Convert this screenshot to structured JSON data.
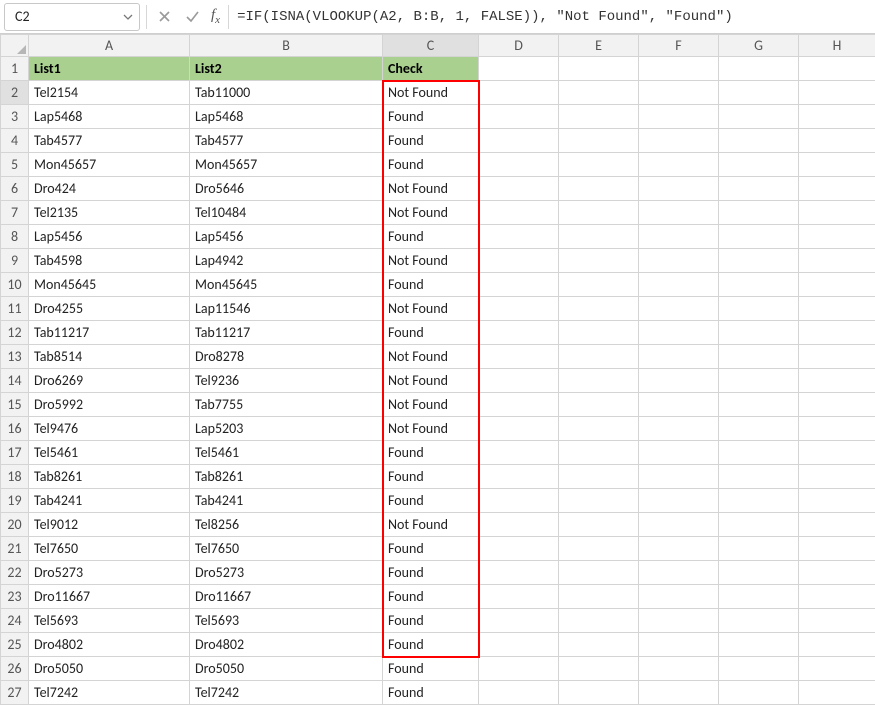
{
  "nameBox": {
    "value": "C2"
  },
  "formulaBar": {
    "formula": "=IF(ISNA(VLOOKUP(A2, B:B, 1, FALSE)), \"Not Found\", \"Found\")"
  },
  "columns": [
    "A",
    "B",
    "C",
    "D",
    "E",
    "F",
    "G",
    "H"
  ],
  "headers": {
    "A": "List1",
    "B": "List2",
    "C": "Check"
  },
  "selectedCell": "C2",
  "highlight": {
    "range": "C2:C25"
  },
  "rows": [
    {
      "n": 2,
      "A": "Tel2154",
      "B": "Tab11000",
      "C": "Not Found"
    },
    {
      "n": 3,
      "A": "Lap5468",
      "B": "Lap5468",
      "C": "Found"
    },
    {
      "n": 4,
      "A": "Tab4577",
      "B": "Tab4577",
      "C": "Found"
    },
    {
      "n": 5,
      "A": "Mon45657",
      "B": "Mon45657",
      "C": "Found"
    },
    {
      "n": 6,
      "A": "Dro424",
      "B": "Dro5646",
      "C": "Not Found"
    },
    {
      "n": 7,
      "A": "Tel2135",
      "B": "Tel10484",
      "C": "Not Found"
    },
    {
      "n": 8,
      "A": "Lap5456",
      "B": "Lap5456",
      "C": "Found"
    },
    {
      "n": 9,
      "A": "Tab4598",
      "B": "Lap4942",
      "C": "Not Found"
    },
    {
      "n": 10,
      "A": "Mon45645",
      "B": "Mon45645",
      "C": "Found"
    },
    {
      "n": 11,
      "A": "Dro4255",
      "B": "Lap11546",
      "C": "Not Found"
    },
    {
      "n": 12,
      "A": "Tab11217",
      "B": "Tab11217",
      "C": "Found"
    },
    {
      "n": 13,
      "A": "Tab8514",
      "B": "Dro8278",
      "C": "Not Found"
    },
    {
      "n": 14,
      "A": "Dro6269",
      "B": "Tel9236",
      "C": "Not Found"
    },
    {
      "n": 15,
      "A": "Dro5992",
      "B": "Tab7755",
      "C": "Not Found"
    },
    {
      "n": 16,
      "A": "Tel9476",
      "B": "Lap5203",
      "C": "Not Found"
    },
    {
      "n": 17,
      "A": "Tel5461",
      "B": "Tel5461",
      "C": "Found"
    },
    {
      "n": 18,
      "A": "Tab8261",
      "B": "Tab8261",
      "C": "Found"
    },
    {
      "n": 19,
      "A": "Tab4241",
      "B": "Tab4241",
      "C": "Found"
    },
    {
      "n": 20,
      "A": "Tel9012",
      "B": "Tel8256",
      "C": "Not Found"
    },
    {
      "n": 21,
      "A": "Tel7650",
      "B": "Tel7650",
      "C": "Found"
    },
    {
      "n": 22,
      "A": "Dro5273",
      "B": "Dro5273",
      "C": "Found"
    },
    {
      "n": 23,
      "A": "Dro11667",
      "B": "Dro11667",
      "C": "Found"
    },
    {
      "n": 24,
      "A": "Tel5693",
      "B": "Tel5693",
      "C": "Found"
    },
    {
      "n": 25,
      "A": "Dro4802",
      "B": "Dro4802",
      "C": "Found"
    },
    {
      "n": 26,
      "A": "Dro5050",
      "B": "Dro5050",
      "C": "Found"
    },
    {
      "n": 27,
      "A": "Tel7242",
      "B": "Tel7242",
      "C": "Found"
    }
  ]
}
